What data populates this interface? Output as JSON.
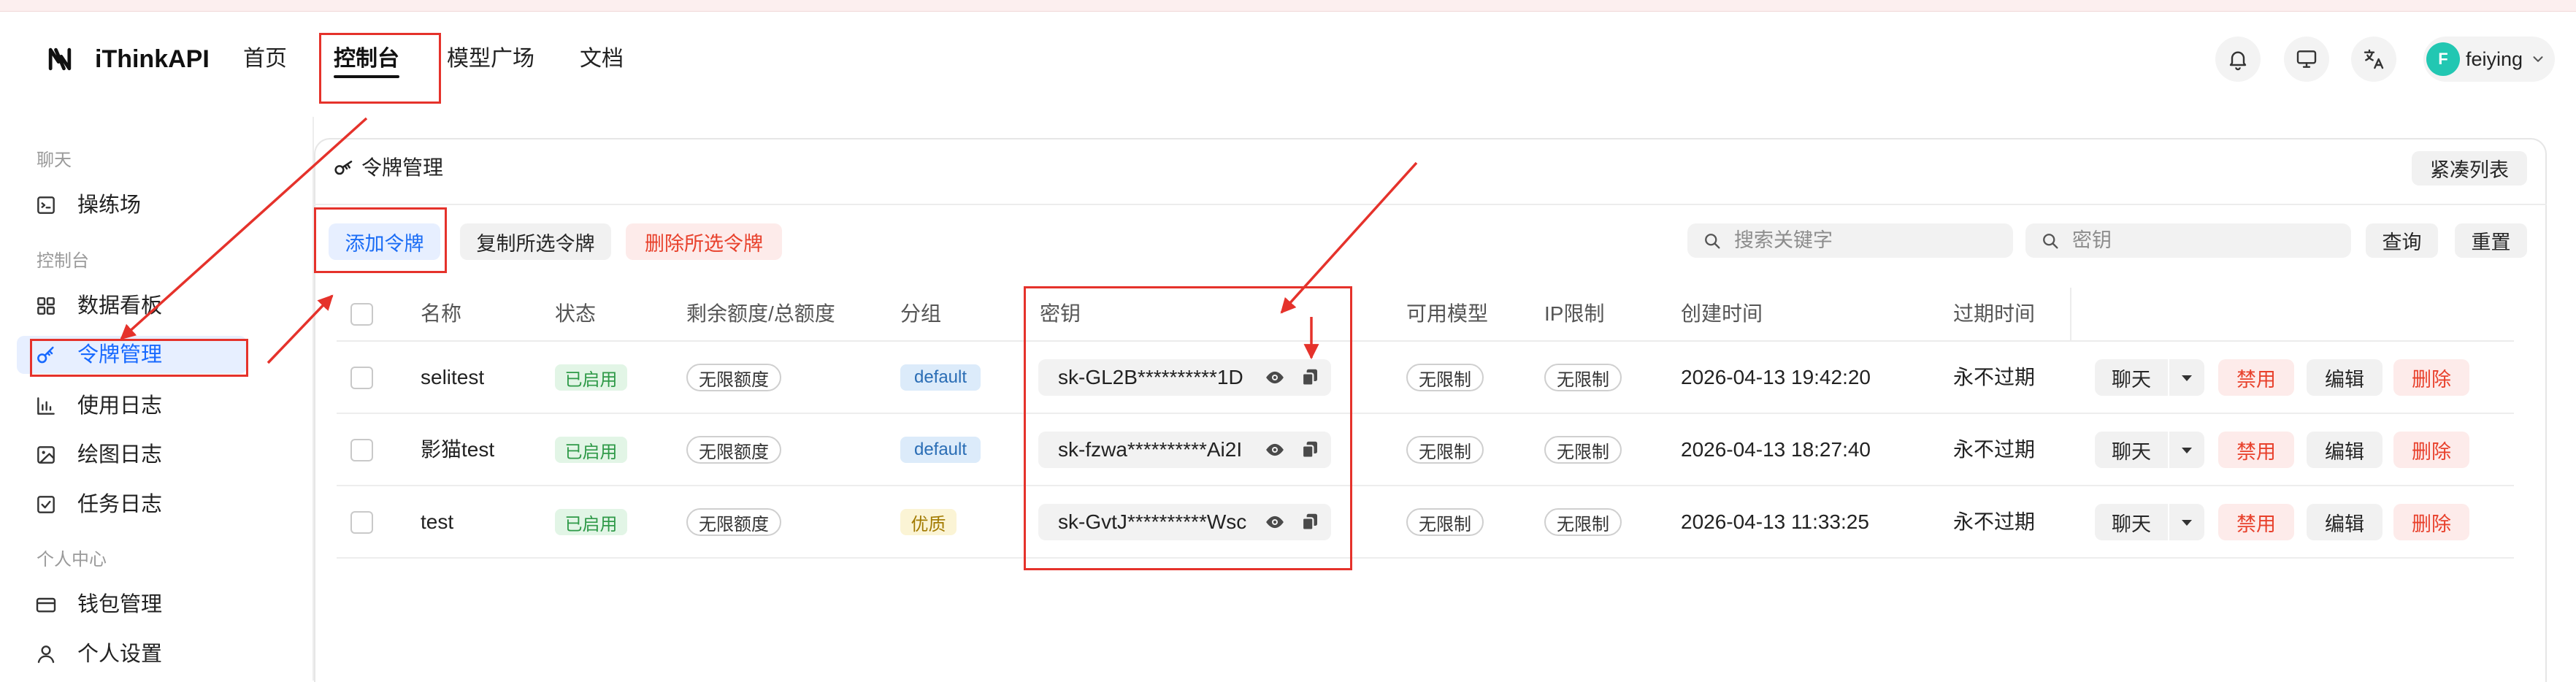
{
  "header": {
    "brand": "iThinkAPI",
    "nav": [
      {
        "label": "首页"
      },
      {
        "label": "控制台",
        "active": true
      },
      {
        "label": "模型广场"
      },
      {
        "label": "文档"
      }
    ],
    "icons": [
      "bell-icon",
      "monitor-icon",
      "translate-icon"
    ],
    "user": {
      "avatar_letter": "F",
      "name": "feiying"
    }
  },
  "sidebar": {
    "sections": [
      {
        "label": "聊天",
        "items": [
          {
            "label": "操练场",
            "icon": "playground-icon"
          }
        ]
      },
      {
        "label": "控制台",
        "items": [
          {
            "label": "数据看板",
            "icon": "dashboard-icon"
          },
          {
            "label": "令牌管理",
            "icon": "key-icon",
            "active": true
          },
          {
            "label": "使用日志",
            "icon": "bar-chart-icon"
          },
          {
            "label": "绘图日志",
            "icon": "image-icon"
          },
          {
            "label": "任务日志",
            "icon": "task-check-icon"
          }
        ]
      },
      {
        "label": "个人中心",
        "items": [
          {
            "label": "钱包管理",
            "icon": "wallet-icon"
          },
          {
            "label": "个人设置",
            "icon": "user-icon"
          }
        ]
      }
    ]
  },
  "main": {
    "title": "令牌管理",
    "compact_toggle": "紧凑列表",
    "toolbar": {
      "add": "添加令牌",
      "copy_selected": "复制所选令牌",
      "delete_selected": "删除所选令牌"
    },
    "search": {
      "keyword_placeholder": "搜索关键字",
      "key_placeholder": "密钥",
      "query": "查询",
      "reset": "重置"
    },
    "table": {
      "columns": [
        "名称",
        "状态",
        "剩余额度/总额度",
        "分组",
        "密钥",
        "可用模型",
        "IP限制",
        "创建时间",
        "过期时间"
      ],
      "rows": [
        {
          "name": "selitest",
          "status": "已启用",
          "quota": "无限额度",
          "group": "default",
          "group_bg": "#dcebfa",
          "group_fg": "#2a6db5",
          "key": "sk-GL2B**********1D",
          "models": "无限制",
          "ip": "无限制",
          "created": "2026-04-13 19:42:20",
          "expires": "永不过期"
        },
        {
          "name": "影猫test",
          "status": "已启用",
          "quota": "无限额度",
          "group": "default",
          "group_bg": "#dcebfa",
          "group_fg": "#2a6db5",
          "key": "sk-fzwa**********Ai2I",
          "models": "无限制",
          "ip": "无限制",
          "created": "2026-04-13 18:27:40",
          "expires": "永不过期"
        },
        {
          "name": "test",
          "status": "已启用",
          "quota": "无限额度",
          "group": "优质",
          "group_bg": "#fbf4d5",
          "group_fg": "#a27a00",
          "key": "sk-GvtJ**********Wsc",
          "models": "无限制",
          "ip": "无限制",
          "created": "2026-04-13 11:33:25",
          "expires": "永不过期"
        }
      ],
      "row_actions": {
        "chat": "聊天",
        "disable": "禁用",
        "edit": "编辑",
        "delete": "删除"
      }
    }
  },
  "colors": {
    "accent": "#1a6cf5",
    "danger": "#e8412c",
    "success": "#2f9a48",
    "avatar": "#22c7b2",
    "annotation": "#e5322b"
  }
}
